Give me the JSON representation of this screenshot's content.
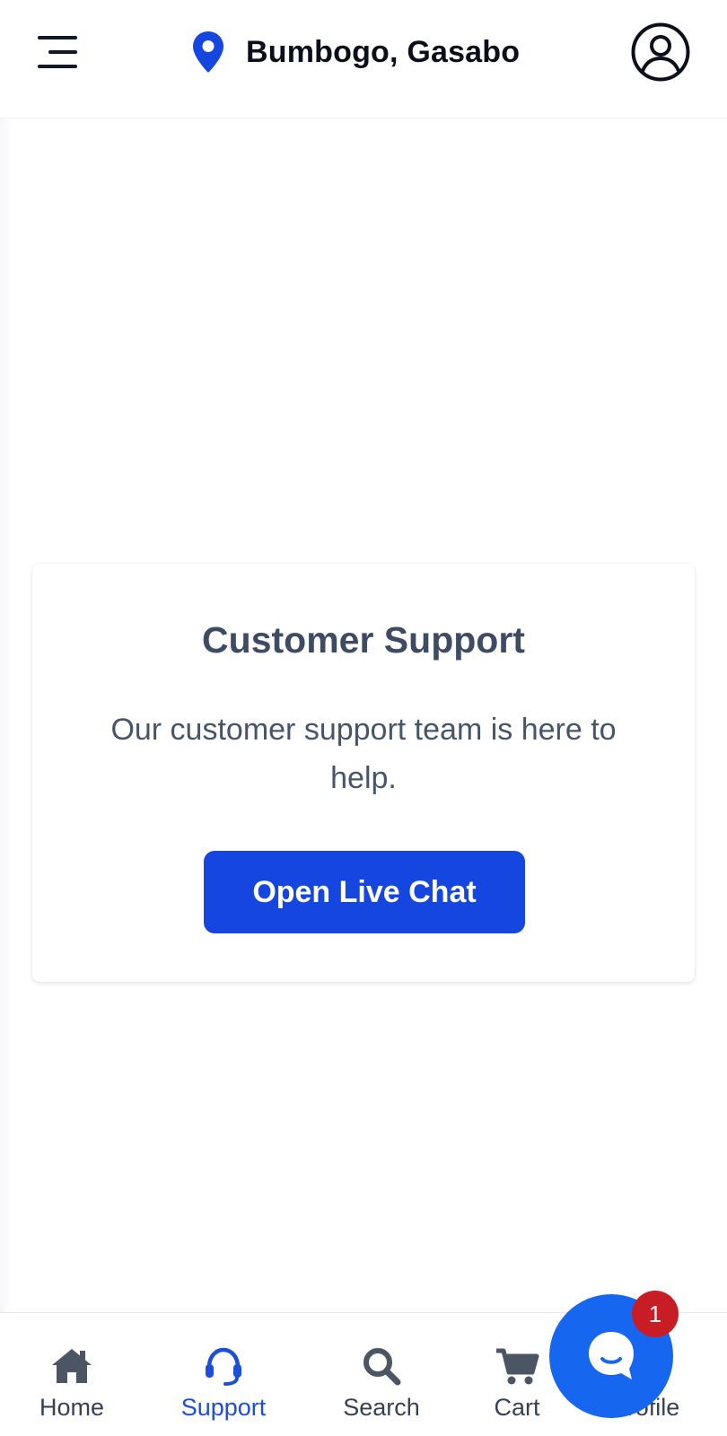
{
  "header": {
    "location": "Bumbogo, Gasabo",
    "icons": {
      "menu": "menu-icon",
      "location": "map-pin-icon",
      "account": "user-circle-icon"
    },
    "accent_color": "#1646e0"
  },
  "support_card": {
    "title": "Customer Support",
    "description": "Our customer support team is here to help.",
    "button_label": "Open Live Chat"
  },
  "bottom_nav": {
    "items": [
      {
        "label": "Home",
        "icon": "home-icon",
        "active": false
      },
      {
        "label": "Support",
        "icon": "headset-icon",
        "active": true
      },
      {
        "label": "Search",
        "icon": "search-icon",
        "active": false
      },
      {
        "label": "Cart",
        "icon": "cart-icon",
        "active": false
      },
      {
        "label": "Profile",
        "icon": "profile-icon",
        "active": false
      }
    ],
    "active_color": "#1d4ed8"
  },
  "chat_widget": {
    "icon": "chat-bubble-icon",
    "unread_count": "1",
    "color": "#1666f0",
    "badge_color": "#c81d25"
  }
}
